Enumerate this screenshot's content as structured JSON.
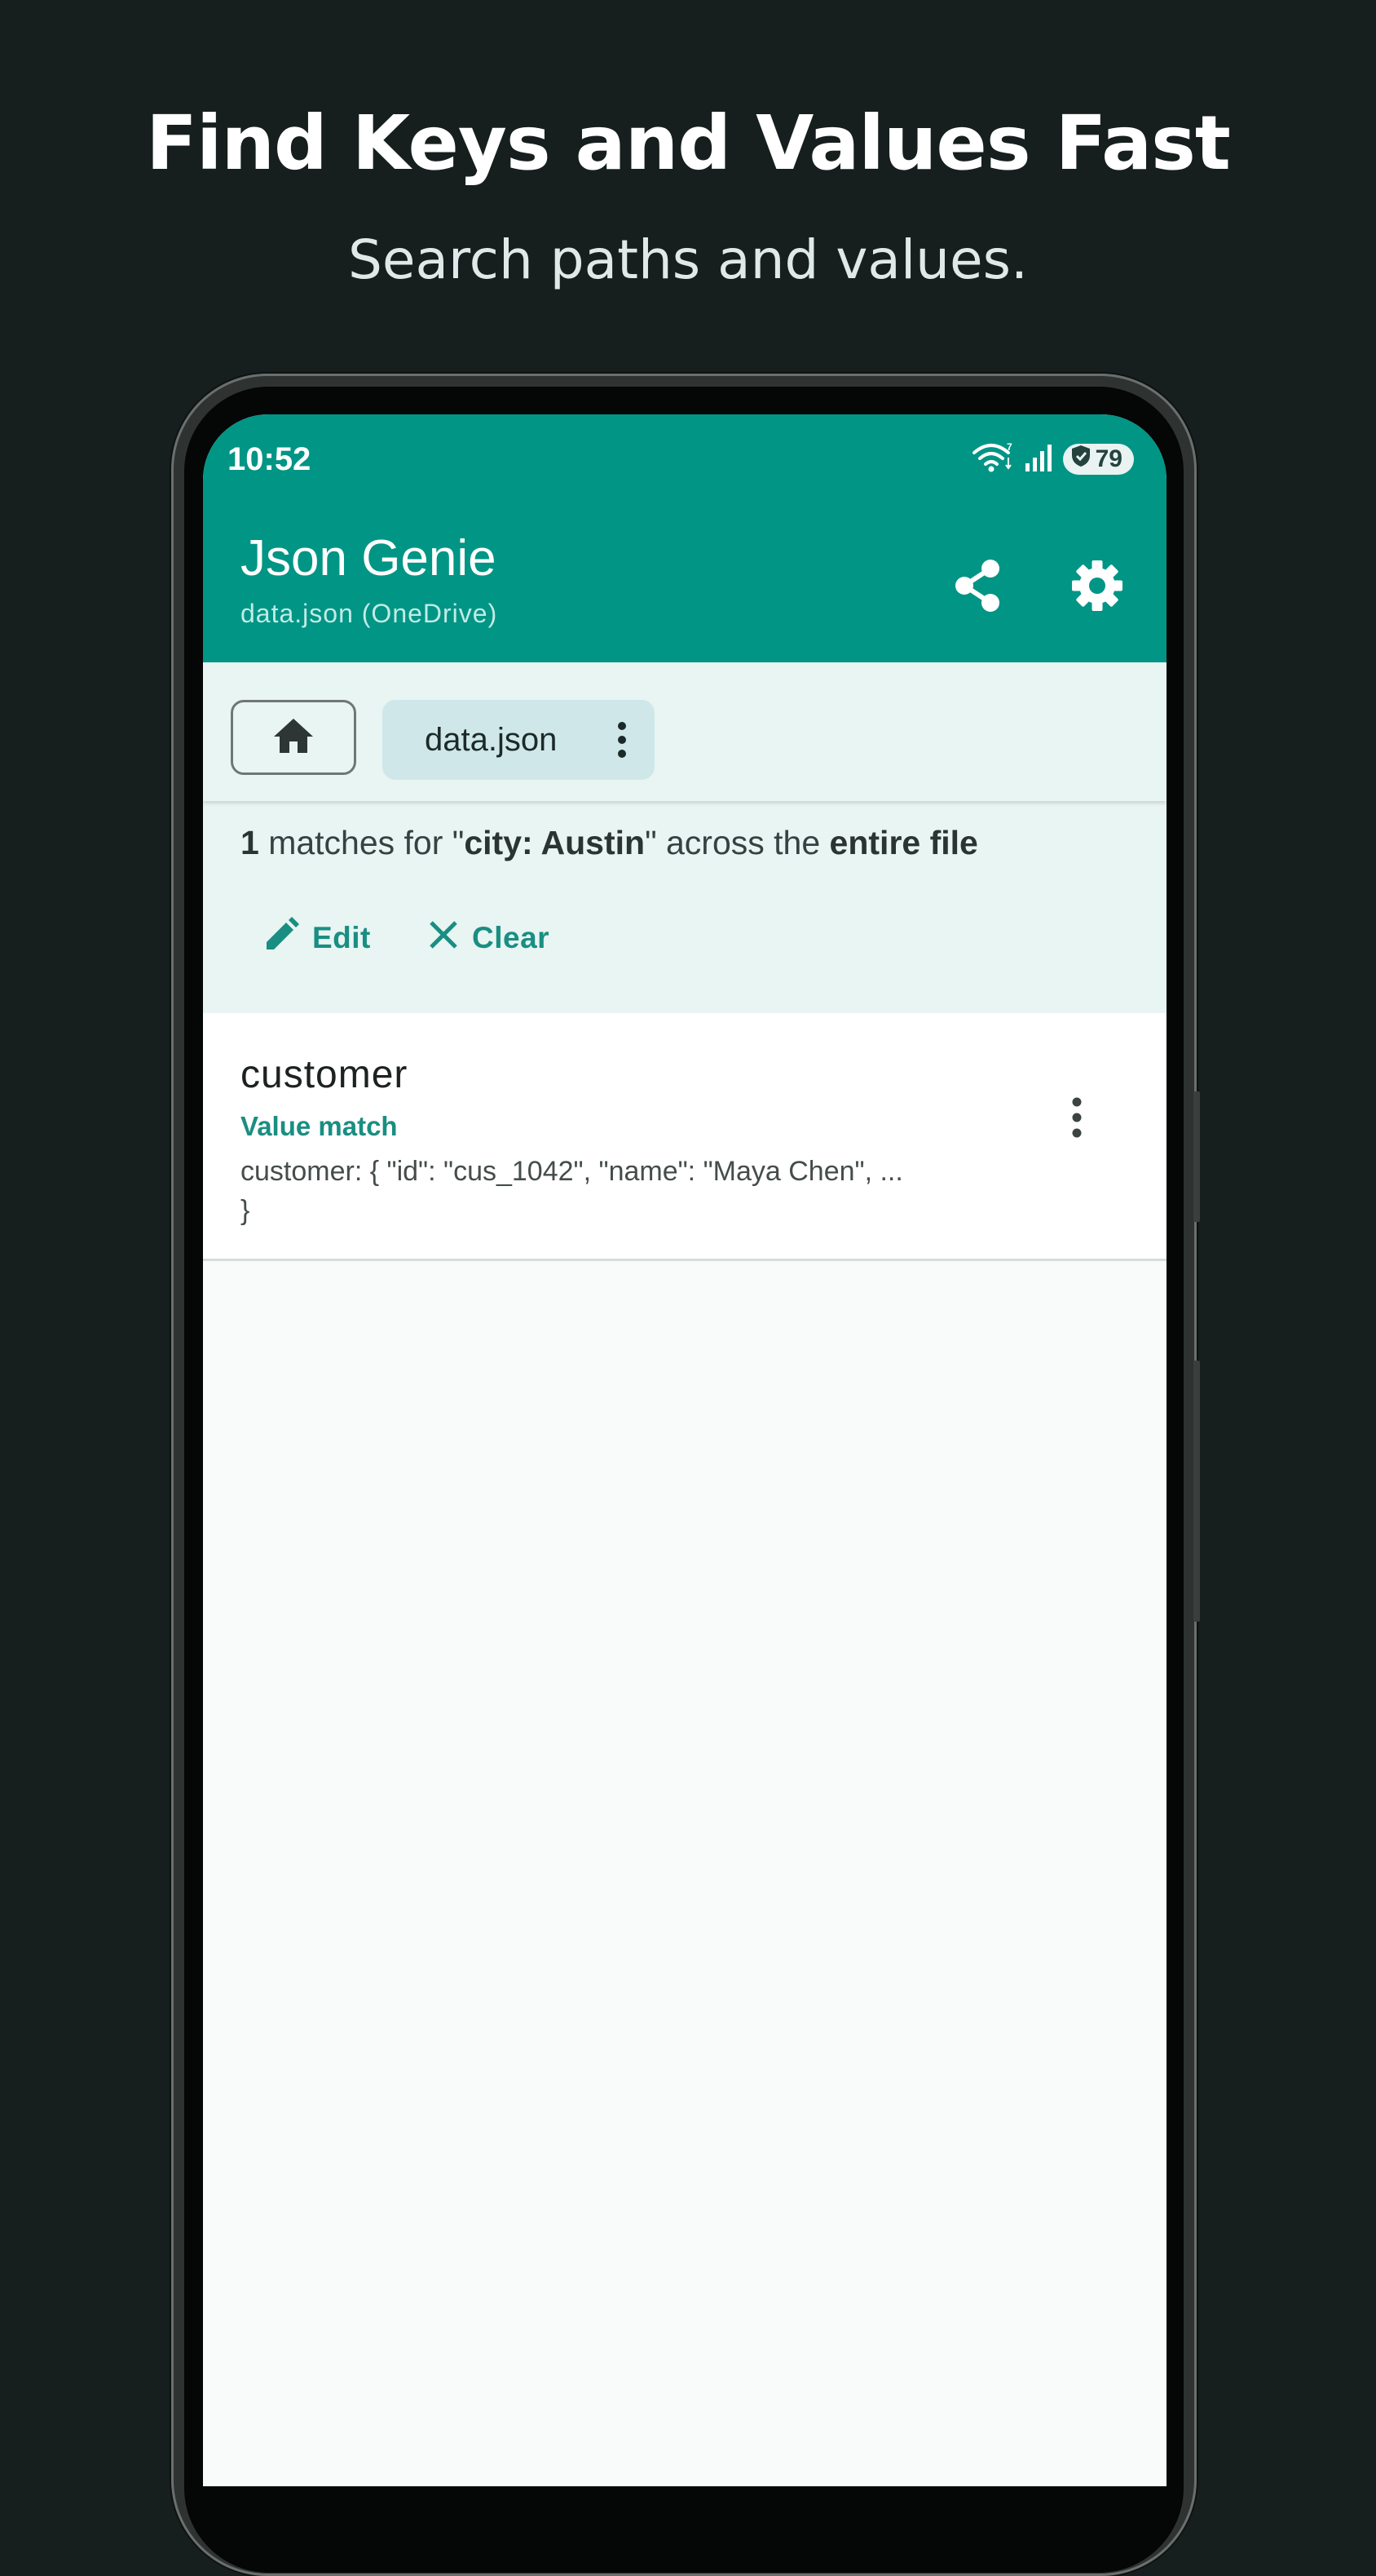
{
  "promo": {
    "title": "Find Keys and Values Fast",
    "subtitle": "Search paths and values."
  },
  "status_bar": {
    "time": "10:52",
    "battery_level": "79",
    "icons": [
      "wifi-icon",
      "signal-icon",
      "battery-shield-icon"
    ]
  },
  "app_bar": {
    "title": "Json Genie",
    "subtitle": "data.json (OneDrive)",
    "actions": [
      "share-icon",
      "settings-gear-icon"
    ]
  },
  "toolbar": {
    "home_icon": "home-icon",
    "file_chip_label": "data.json",
    "file_chip_menu_icon": "more-vert-icon"
  },
  "search": {
    "count": "1",
    "text_matches_for": " matches for \"",
    "query": "city: Austin",
    "text_across": "\" across the ",
    "scope": "entire file",
    "edit_label": "Edit",
    "clear_label": "Clear"
  },
  "results": [
    {
      "key": "customer",
      "match_type": "Value match",
      "preview": "customer: { \"id\": \"cus_1042\", \"name\": \"Maya Chen\", ... }"
    }
  ],
  "colors": {
    "page_background": "#161f1e",
    "app_bar": "#009585",
    "panel_background": "#e8f5f2",
    "accent_text": "#1a8e82",
    "chip_background": "#cfe7e8"
  }
}
